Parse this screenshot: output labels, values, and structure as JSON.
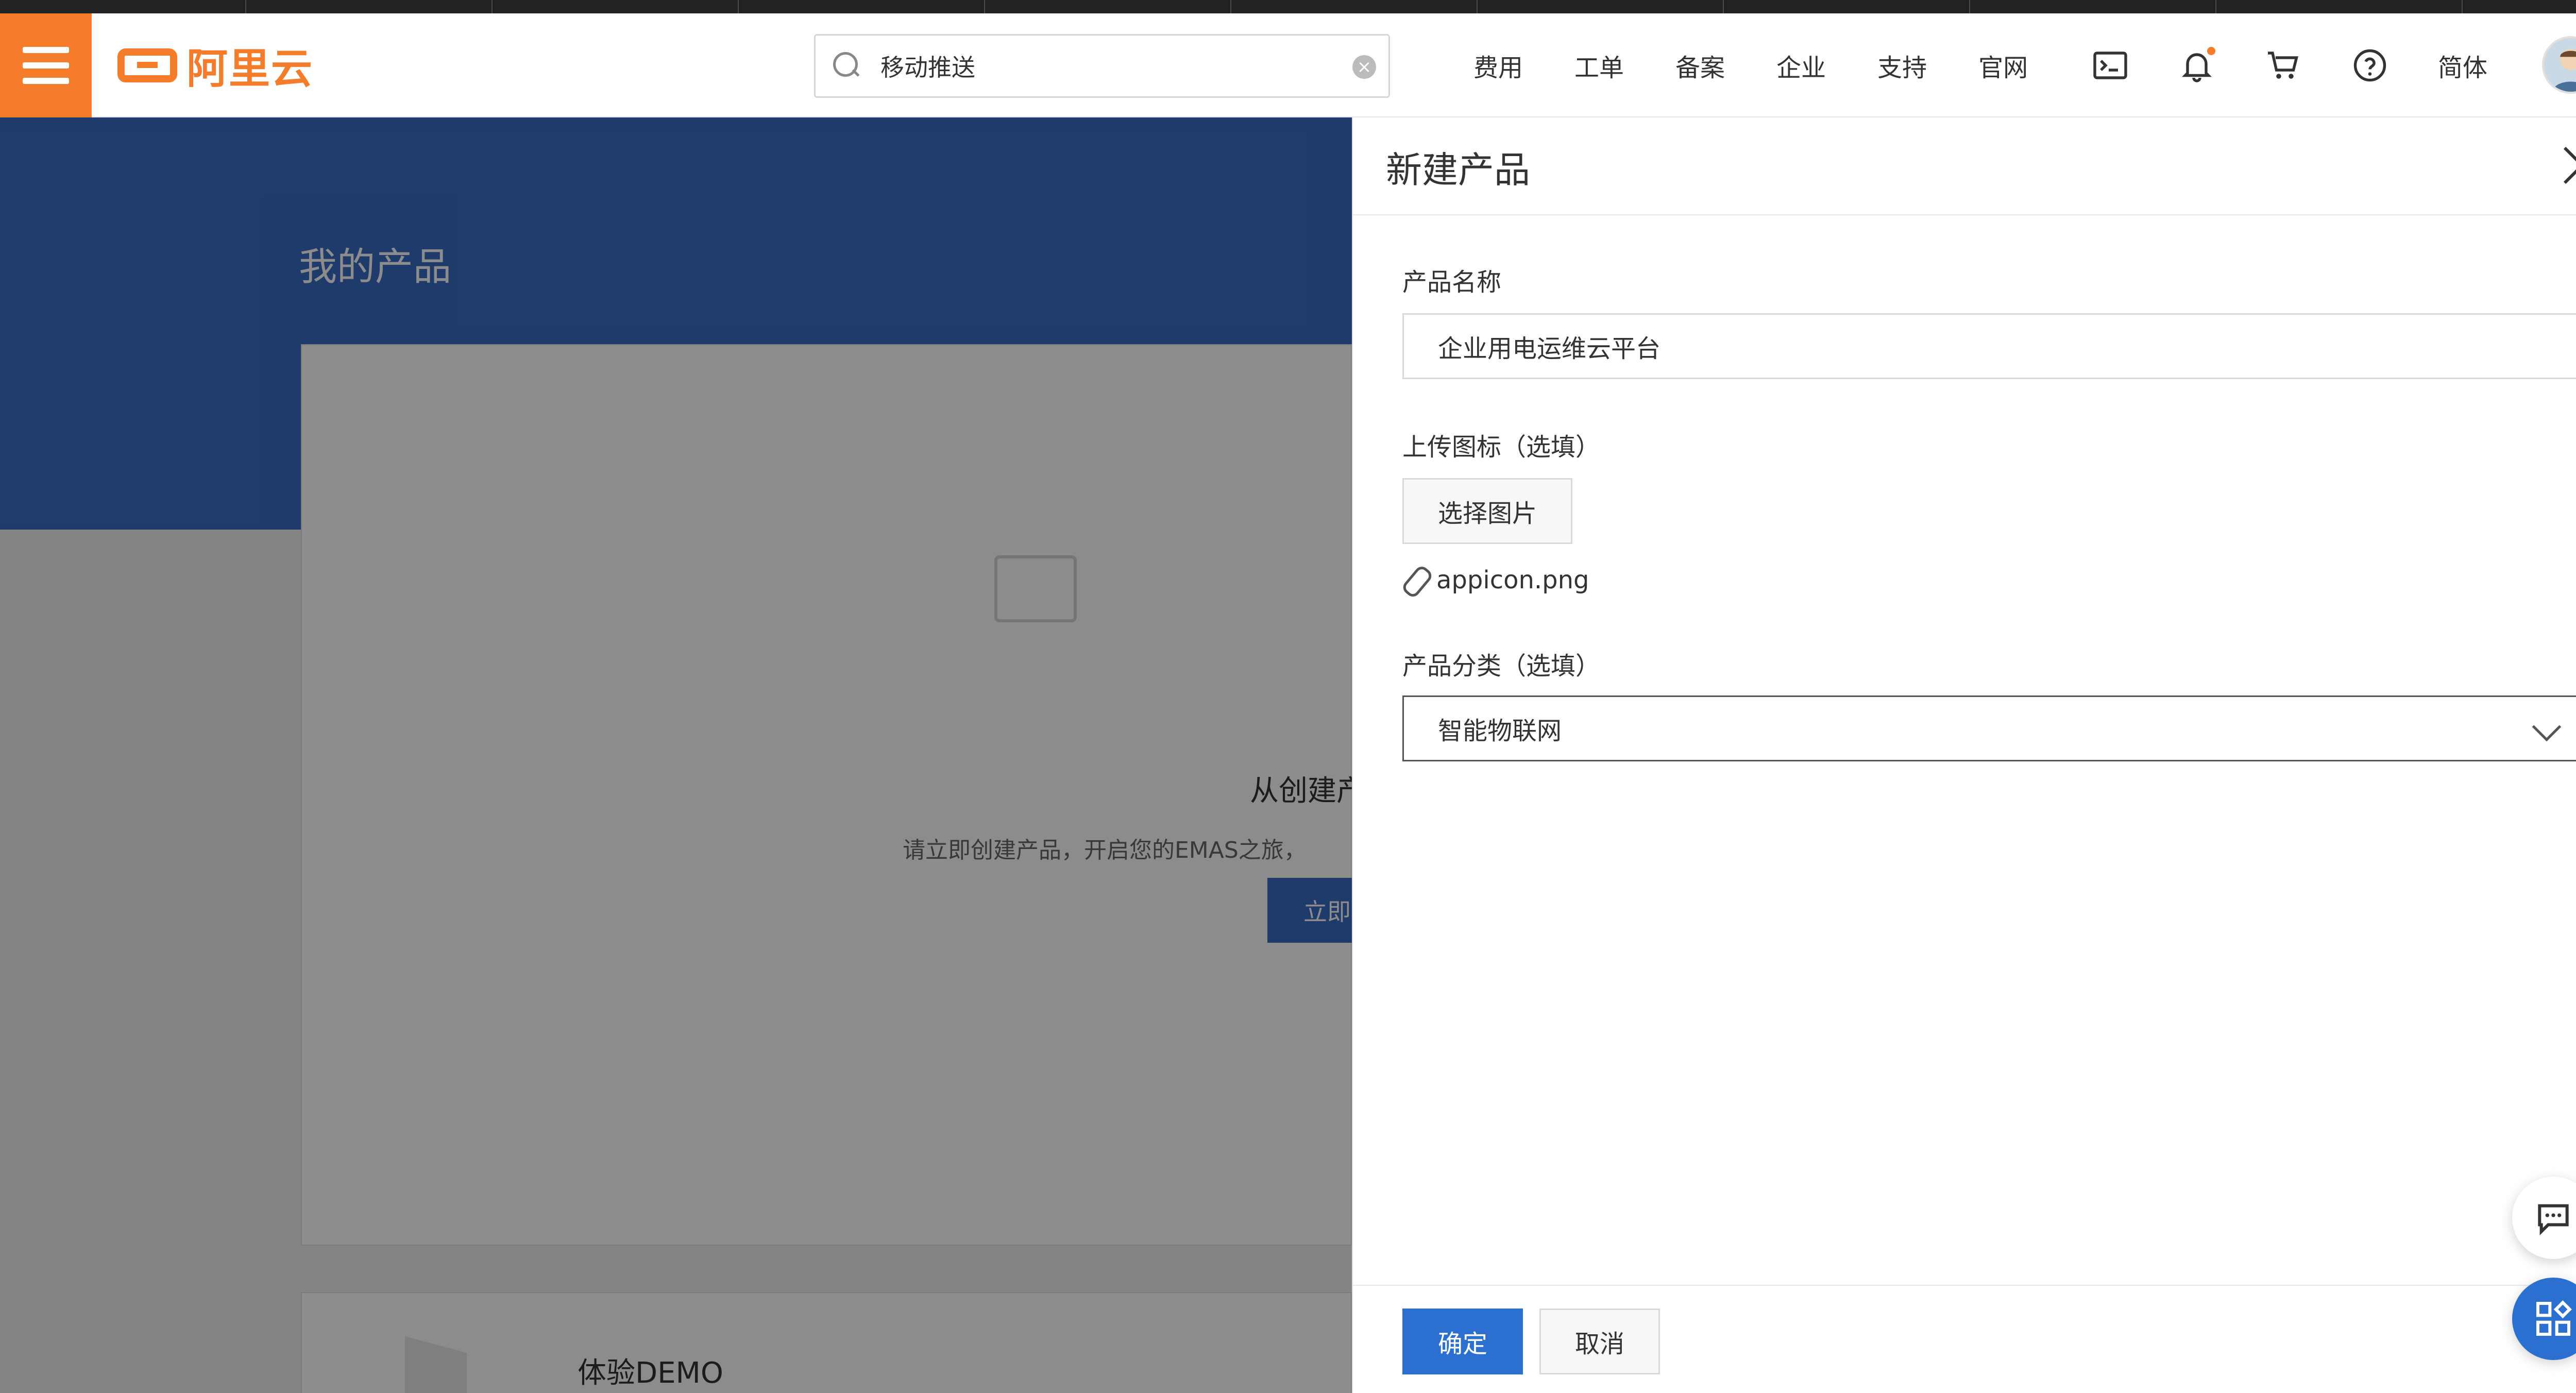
{
  "topnav": {
    "logo_text": "阿里云",
    "search": {
      "value": "移动推送"
    },
    "links": [
      "费用",
      "工单",
      "备案",
      "企业",
      "支持",
      "官网"
    ],
    "language": "简体",
    "icons": [
      "terminal-icon",
      "bell-icon",
      "cart-icon",
      "help-icon"
    ]
  },
  "page": {
    "title": "我的产品",
    "empty_title": "从创建产",
    "empty_desc": "请立即创建产品，开启您的EMAS之旅，",
    "create_button": "立即",
    "demo_title": "体验DEMO"
  },
  "drawer": {
    "title": "新建产品",
    "product_name_label": "产品名称",
    "product_name_value": "企业用电运维云平台",
    "upload_label": "上传图标（选填）",
    "upload_button": "选择图片",
    "file_name": "appicon.png",
    "category_label": "产品分类（选填）",
    "category_value": "智能物联网",
    "ok_button": "确定",
    "cancel_button": "取消"
  },
  "colors": {
    "brand_orange": "#f47c2a",
    "primary_blue": "#2b6fd0",
    "banner_blue": "#3a6cc4"
  }
}
